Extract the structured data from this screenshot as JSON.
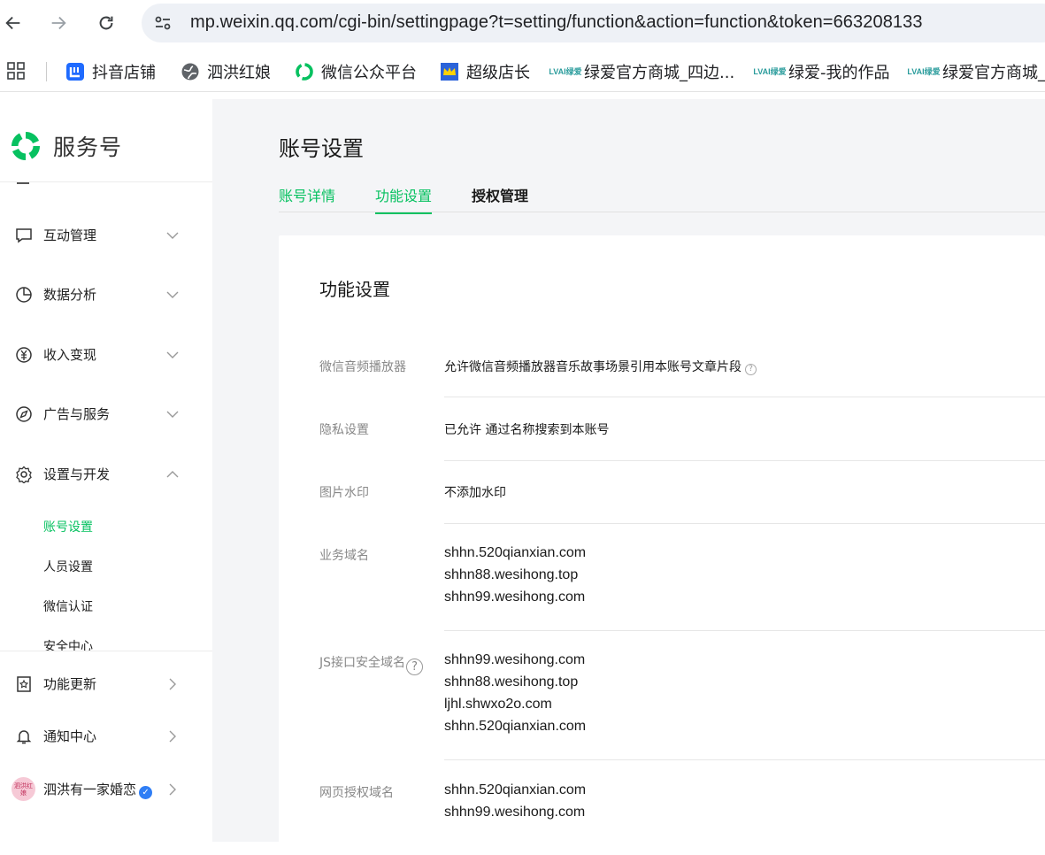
{
  "browser": {
    "url": "mp.weixin.qq.com/cgi-bin/settingpage?t=setting/function&action=function&token=663208133",
    "bookmarks": [
      "抖音店铺",
      "泗洪红娘",
      "微信公众平台",
      "超级店长",
      "绿爱官方商城_四边...",
      "绿爱-我的作品",
      "绿爱官方商城_"
    ],
    "lvai_badge_top": "LVAI",
    "lvai_badge_bottom": "绿爱"
  },
  "sidebar": {
    "logo_text": "服务号",
    "menus": [
      {
        "label": "互动管理",
        "icon": "chat-icon"
      },
      {
        "label": "数据分析",
        "icon": "pie-chart-icon"
      },
      {
        "label": "收入变现",
        "icon": "yen-icon"
      },
      {
        "label": "广告与服务",
        "icon": "compass-icon"
      },
      {
        "label": "设置与开发",
        "icon": "gear-icon"
      }
    ],
    "submenu": [
      "账号设置",
      "人员设置",
      "微信认证",
      "安全中心"
    ],
    "bottom": [
      {
        "label": "功能更新",
        "icon": "update-icon"
      },
      {
        "label": "通知中心",
        "icon": "bell-icon"
      }
    ],
    "account_name": "泗洪有一家婚恋",
    "avatar_text": "泗洪红娘"
  },
  "main": {
    "title": "账号设置",
    "tabs": [
      "账号详情",
      "功能设置",
      "授权管理"
    ],
    "active_tab": 1,
    "card_title": "功能设置",
    "rows": {
      "audio_label": "微信音频播放器",
      "audio_value": "允许微信音频播放器音乐故事场景引用本账号文章片段",
      "privacy_label": "隐私设置",
      "privacy_value": "已允许 通过名称搜索到本账号",
      "watermark_label": "图片水印",
      "watermark_value": "不添加水印",
      "biz_label": "业务域名",
      "biz_domains": [
        "shhn.520qianxian.com",
        "shhn88.wesihong.top",
        "shhn99.wesihong.com"
      ],
      "js_label": "JS接口安全域名",
      "js_domains": [
        "shhn99.wesihong.com",
        "shhn88.wesihong.top",
        "ljhl.shwxo2o.com",
        "shhn.520qianxian.com"
      ],
      "oauth_label": "网页授权域名",
      "oauth_domains": [
        "shhn.520qianxian.com",
        "shhn99.wesihong.com"
      ]
    }
  },
  "colors": {
    "accent": "#07c160",
    "verified": "#2f7ef5",
    "bg": "#f4f5f7"
  }
}
